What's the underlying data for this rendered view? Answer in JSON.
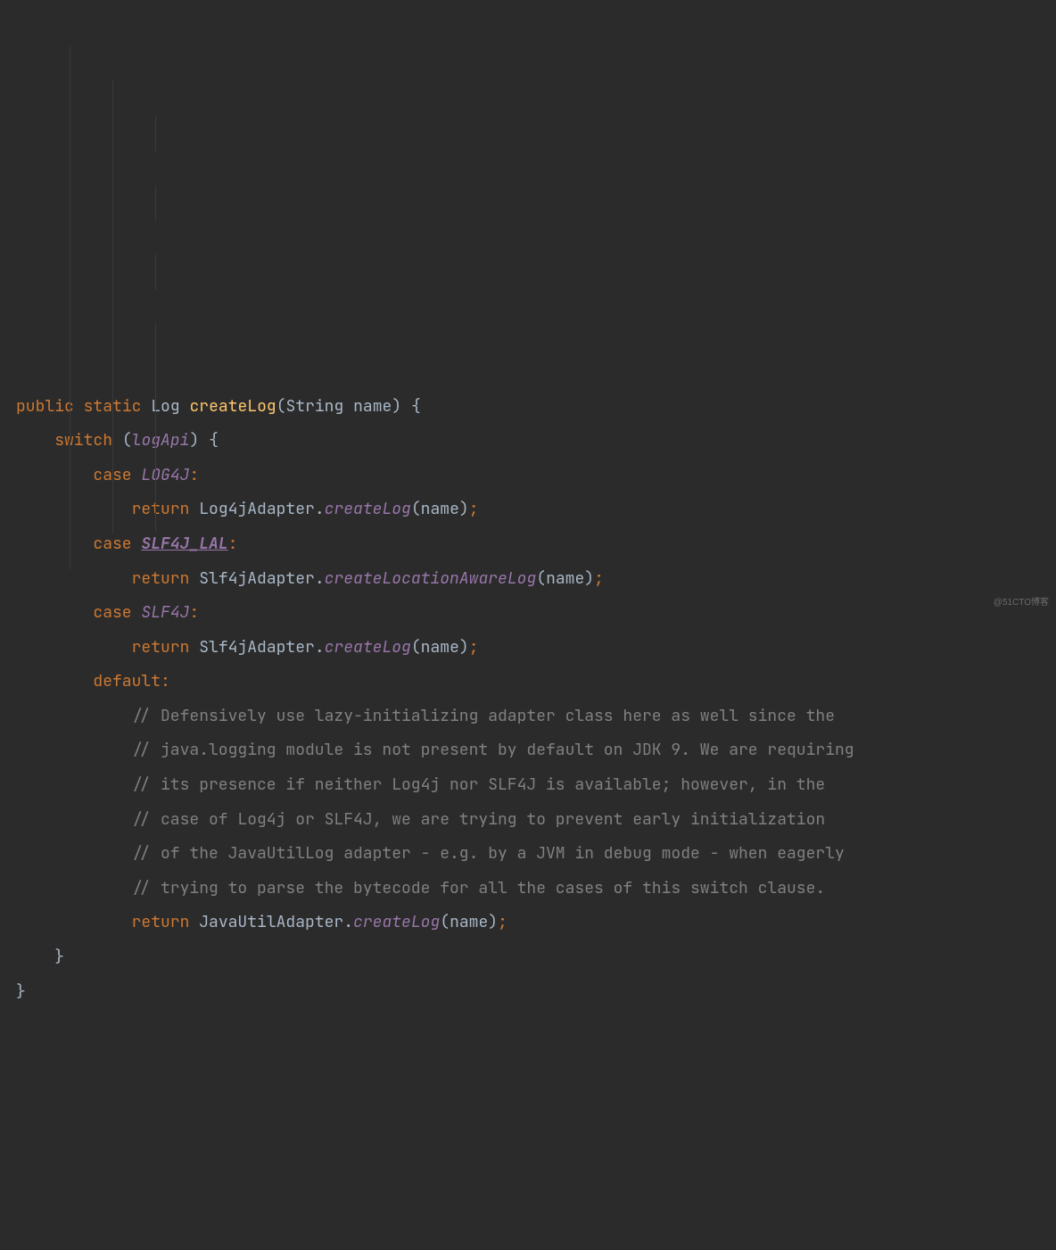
{
  "code": {
    "l1": {
      "kw_public": "public",
      "kw_static": "static",
      "type_Log": "Log",
      "method_createLog": "createLog",
      "lparen": "(",
      "type_String": "String",
      "param_name": "name",
      "rparen": ")",
      "lbrace": "{"
    },
    "l2": {
      "kw_switch": "switch",
      "lparen": "(",
      "field_logApi": "logApi",
      "rparen": ")",
      "lbrace": "{"
    },
    "l3": {
      "kw_case": "case",
      "const_LOG4J": "LOG4J",
      "colon": ":"
    },
    "l4": {
      "kw_return": "return",
      "cls_Log4jAdapter": "Log4jAdapter",
      "dot": ".",
      "call_createLog": "createLog",
      "lparen": "(",
      "arg_name": "name",
      "rparen": ")",
      "semi": ";"
    },
    "l5": {
      "kw_case": "case",
      "const_SLF4J_LAL": "SLF4J_LAL",
      "colon": ":"
    },
    "l6": {
      "kw_return": "return",
      "cls_Slf4jAdapter": "Slf4jAdapter",
      "dot": ".",
      "call_createLocationAwareLog": "createLocationAwareLog",
      "lparen": "(",
      "arg_name": "name",
      "rparen": ")",
      "semi": ";"
    },
    "l7": {
      "kw_case": "case",
      "const_SLF4J": "SLF4J",
      "colon": ":"
    },
    "l8": {
      "kw_return": "return",
      "cls_Slf4jAdapter": "Slf4jAdapter",
      "dot": ".",
      "call_createLog": "createLog",
      "lparen": "(",
      "arg_name": "name",
      "rparen": ")",
      "semi": ";"
    },
    "l9": {
      "kw_default": "default",
      "colon": ":"
    },
    "l10": {
      "comment": "// Defensively use lazy-initializing adapter class here as well since the"
    },
    "l11": {
      "comment": "// java.logging module is not present by default on JDK 9. We are requiring"
    },
    "l12": {
      "comment": "// its presence if neither Log4j nor SLF4J is available; however, in the"
    },
    "l13": {
      "comment": "// case of Log4j or SLF4J, we are trying to prevent early initialization"
    },
    "l14": {
      "comment": "// of the JavaUtilLog adapter - e.g. by a JVM in debug mode - when eagerly"
    },
    "l15": {
      "comment": "// trying to parse the bytecode for all the cases of this switch clause."
    },
    "l16": {
      "kw_return": "return",
      "cls_JavaUtilAdapter": "JavaUtilAdapter",
      "dot": ".",
      "call_createLog": "createLog",
      "lparen": "(",
      "arg_name": "name",
      "rparen": ")",
      "semi": ";"
    },
    "l17": {
      "rbrace": "}"
    },
    "l18": {
      "rbrace": "}"
    }
  },
  "watermark": "@51CTO博客"
}
